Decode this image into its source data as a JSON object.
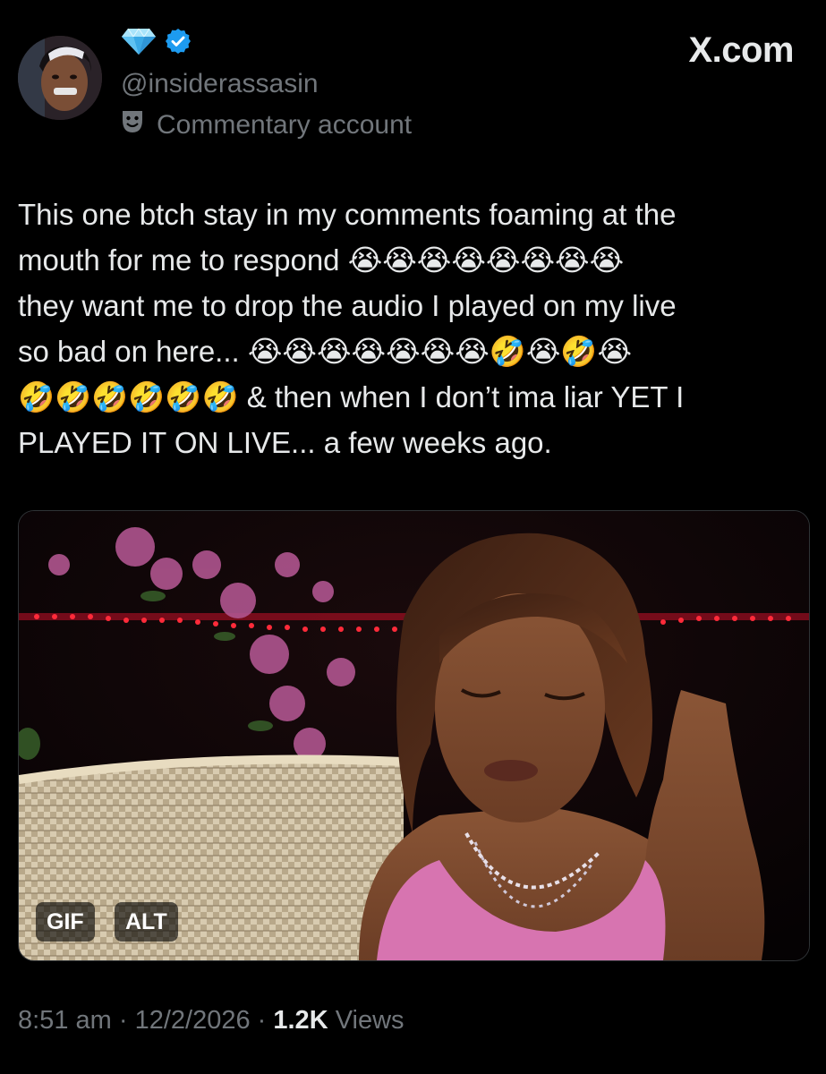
{
  "header": {
    "handle": "@insiderassasin",
    "account_label": "Commentary account",
    "site_logo_text": "X.com",
    "verified_color": "#1d9bf0",
    "diamond_color": "#4fb8f0"
  },
  "tweet": {
    "lines": [
      "This one btch stay in my comments foaming at the",
      "mouth for me to respond 😭😭😭😭😭😭😭😭",
      "they want me to drop the audio I played on my live",
      "so bad on here... 😭😭😭😭😭😭😭🤣😭🤣😭",
      "🤣🤣🤣🤣🤣🤣 & then when I don’t ima liar YET I",
      "PLAYED IT ON LIVE... a few weeks ago."
    ]
  },
  "media": {
    "gif_badge": "GIF",
    "alt_badge": "ALT"
  },
  "meta": {
    "time": "8:51 am",
    "separator": " · ",
    "date": "12/2/2026",
    "views_count": "1.2K",
    "views_label": "Views"
  }
}
